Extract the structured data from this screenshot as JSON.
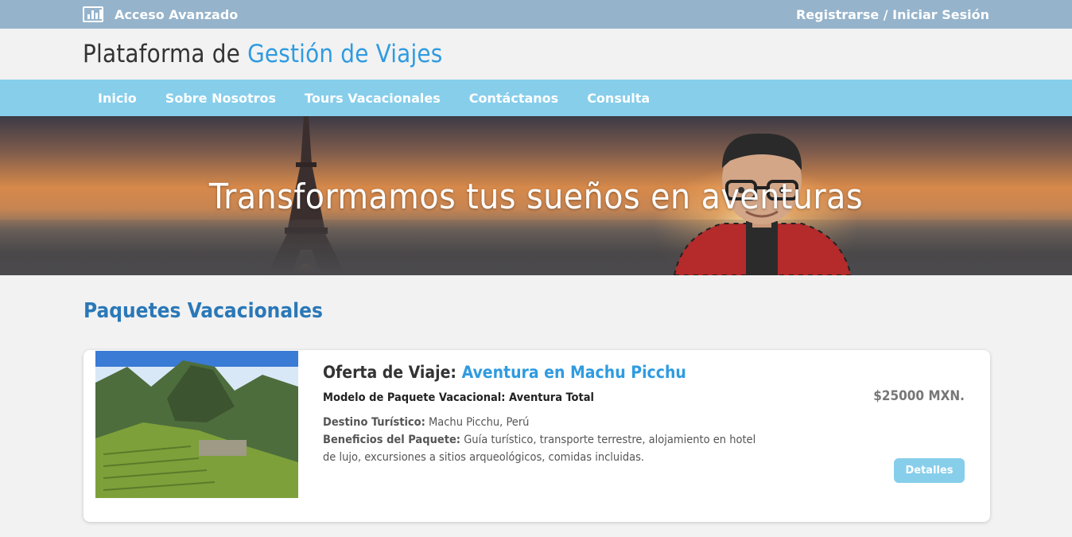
{
  "topbar": {
    "icon": "bar-chart-icon",
    "left_label": "Acceso Avanzado",
    "right_label": "Registrarse / Iniciar Sesión"
  },
  "brand": {
    "title_prefix": "Plataforma de",
    "title_accent": "Gestión de Viajes",
    "accent_color": "#2f9be0"
  },
  "nav": {
    "items": [
      {
        "label": "Inicio"
      },
      {
        "label": "Sobre Nosotros"
      },
      {
        "label": "Tours Vacacionales"
      },
      {
        "label": "Contáctanos"
      },
      {
        "label": "Consulta"
      }
    ],
    "background": "#87ceeb"
  },
  "hero": {
    "headline": "Transformamos tus sueños en aventuras"
  },
  "section": {
    "title": "Paquetes Vacacionales"
  },
  "package": {
    "offer_prefix": "Oferta de Viaje:",
    "offer_name": "Aventura en Machu Picchu",
    "model": "Modelo de Paquete Vacacional: Aventura Total",
    "destination_label": "Destino Turístico:",
    "destination_value": "Machu Picchu, Perú",
    "benefits_label": "Beneficios del Paquete:",
    "benefits_value": "Guía turístico, transporte terrestre, alojamiento en hotel de lujo, excursiones a sitios arqueológicos, comidas incluidas.",
    "price": "$25000 MXN.",
    "details_button": "Detalles"
  }
}
